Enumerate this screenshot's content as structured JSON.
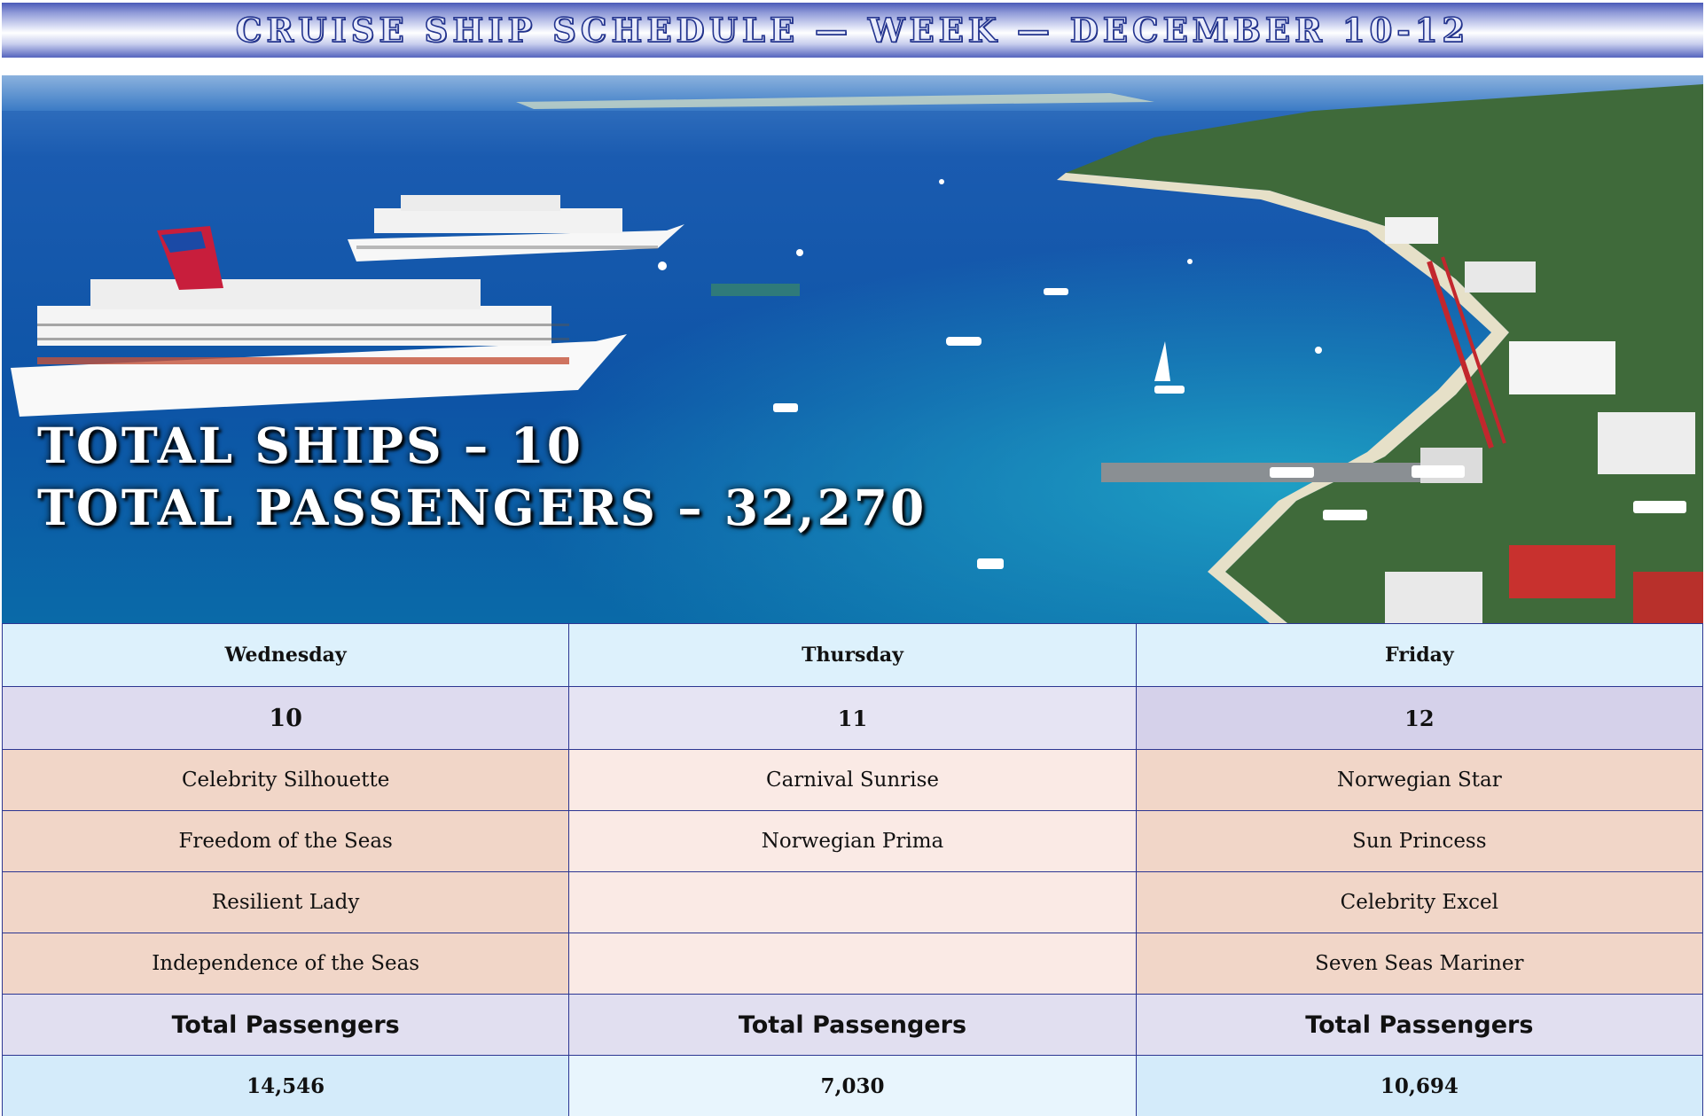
{
  "banner": {
    "title": "CRUISE SHIP SCHEDULE — WEEK — DECEMBER 10-12"
  },
  "hero": {
    "image": "aerial-harbor-cruise-ships-photo",
    "total_ships": "TOTAL SHIPS – 10",
    "total_passengers": "TOTAL PASSENGERS – 32,270"
  },
  "colors": {
    "border": "#2c3692",
    "banner_dark": "#23348f",
    "day_header_bg": "#ddf1fc",
    "ship_cell_bg": "#f1d6c8",
    "ship_cell_alt_bg": "#faeae5",
    "label_bg": "#e1dff0"
  },
  "schedule": {
    "days": [
      "Wednesday",
      "Thursday",
      "Friday"
    ],
    "dates": [
      "10",
      "11",
      "12"
    ],
    "ships": [
      [
        "Celebrity Silhouette",
        "Carnival Sunrise",
        "Norwegian Star"
      ],
      [
        "Freedom of the Seas",
        "Norwegian Prima",
        "Sun Princess"
      ],
      [
        "Resilient Lady",
        "",
        "Celebrity Excel"
      ],
      [
        "Independence of the Seas",
        "",
        "Seven Seas Mariner"
      ]
    ],
    "total_label": "Total Passengers",
    "totals": [
      "14,546",
      "7,030",
      "10,694"
    ]
  }
}
